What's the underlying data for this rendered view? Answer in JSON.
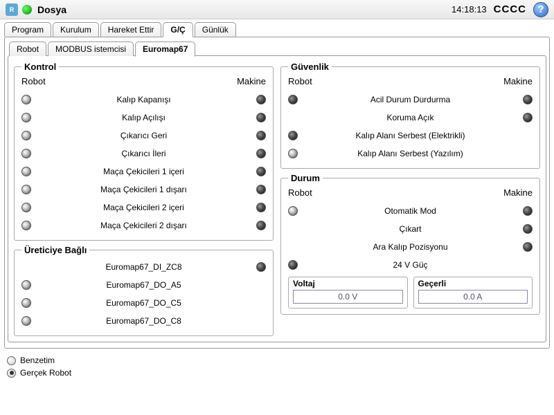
{
  "title": "Dosya",
  "clock": "14:18:13",
  "status_text": "CCCC",
  "tabs": [
    "Program",
    "Kurulum",
    "Hareket Ettir",
    "G/Ç",
    "Günlük"
  ],
  "active_tab": 3,
  "subtabs": [
    "Robot",
    "MODBUS istemcisi",
    "Euromap67"
  ],
  "active_subtab": 2,
  "headers": {
    "robot": "Robot",
    "machine": "Makine"
  },
  "groups": {
    "kontrol": {
      "title": "Kontrol",
      "rows": [
        {
          "label": "Kalıp Kapanışı",
          "l": "off",
          "r": "dark"
        },
        {
          "label": "Kalıp Açılışı",
          "l": "off",
          "r": "dark"
        },
        {
          "label": "Çıkarıcı Geri",
          "l": "off",
          "r": "dark"
        },
        {
          "label": "Çıkarıcı İleri",
          "l": "off",
          "r": "dark"
        },
        {
          "label": "Maça Çekicileri 1 içeri",
          "l": "off",
          "r": "dark"
        },
        {
          "label": "Maça Çekicileri 1 dışarı",
          "l": "off",
          "r": "dark"
        },
        {
          "label": "Maça Çekicileri 2 içeri",
          "l": "off",
          "r": "dark"
        },
        {
          "label": "Maça Çekicileri 2 dışarı",
          "l": "off",
          "r": "dark"
        }
      ]
    },
    "uretici": {
      "title": "Üreticiye Bağlı",
      "rows": [
        {
          "label": "Euromap67_DI_ZC8",
          "l": "blank",
          "r": "dark"
        },
        {
          "label": "Euromap67_DO_A5",
          "l": "off",
          "r": "blank"
        },
        {
          "label": "Euromap67_DO_C5",
          "l": "off",
          "r": "blank"
        },
        {
          "label": "Euromap67_DO_C8",
          "l": "off",
          "r": "blank"
        }
      ]
    },
    "guvenlik": {
      "title": "Güvenlik",
      "rows": [
        {
          "label": "Acil Durum Durdurma",
          "l": "dark",
          "r": "dark"
        },
        {
          "label": "Koruma Açık",
          "l": "blank",
          "r": "dark"
        },
        {
          "label": "Kalıp Alanı Serbest (Elektrikli)",
          "l": "dark",
          "r": "blank"
        },
        {
          "label": "Kalıp Alanı Serbest (Yazılım)",
          "l": "off",
          "r": "blank"
        }
      ]
    },
    "durum": {
      "title": "Durum",
      "rows": [
        {
          "label": "Otomatik Mod",
          "l": "off",
          "r": "dark"
        },
        {
          "label": "Çıkart",
          "l": "blank",
          "r": "dark"
        },
        {
          "label": "Ara Kalıp Pozisyonu",
          "l": "blank",
          "r": "dark"
        },
        {
          "label": "24 V Güç",
          "l": "dark",
          "r": "blank"
        }
      ]
    }
  },
  "metrics": {
    "voltaj": {
      "label": "Voltaj",
      "value": "0.0 V"
    },
    "gecerli": {
      "label": "Geçerli",
      "value": "0.0 A"
    }
  },
  "footer": {
    "sim": "Benzetim",
    "real": "Gerçek Robot",
    "selected": "real"
  }
}
